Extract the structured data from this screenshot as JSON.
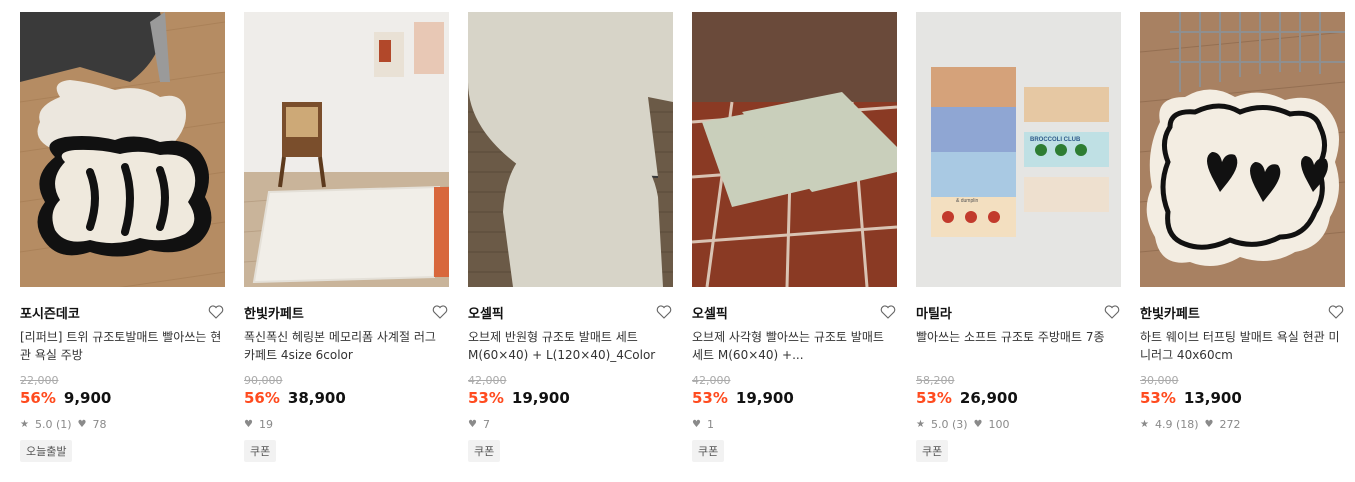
{
  "products": [
    {
      "brand": "포시즌데코",
      "title": "[리퍼브] 트위 규조토발매트 빨아쓰는 현관 욕실 주방",
      "original_price": "22,000",
      "discount": "56%",
      "price": "9,900",
      "rating": "5.0 (1)",
      "likes": "78",
      "badge": "오늘출발"
    },
    {
      "brand": "한빛카페트",
      "title": "폭신폭신 헤링본 메모리폼 사계절 러그 카페트 4size 6color",
      "original_price": "90,000",
      "discount": "56%",
      "price": "38,900",
      "likes": "19",
      "badge": "쿠폰"
    },
    {
      "brand": "오셀픽",
      "title": "오브제 반원형 규조토 발매트 세트 M(60×40) + L(120×40)_4Color",
      "original_price": "42,000",
      "discount": "53%",
      "price": "19,900",
      "likes": "7",
      "badge": "쿠폰"
    },
    {
      "brand": "오셀픽",
      "title": "오브제 사각형 빨아쓰는 규조토 발매트 세트 M(60×40) +...",
      "original_price": "42,000",
      "discount": "53%",
      "price": "19,900",
      "likes": "1",
      "badge": "쿠폰"
    },
    {
      "brand": "마틸라",
      "title": "빨아쓰는 소프트 규조토 주방매트 7종",
      "original_price": "58,200",
      "discount": "53%",
      "price": "26,900",
      "rating": "5.0 (3)",
      "likes": "100",
      "badge": "쿠폰"
    },
    {
      "brand": "한빛카페트",
      "title": "하트 웨이브 터프팅 발매트 욕실 현관 미니러그 40x60cm",
      "original_price": "30,000",
      "discount": "53%",
      "price": "13,900",
      "rating": "4.9 (18)",
      "likes": "272"
    }
  ],
  "mat4_labels": {
    "brand_text": "BROCCOLI CLUB",
    "small_text": "& dumplin"
  },
  "colors": {
    "discount": "#ff4b1f",
    "badge_bg": "#f2f2f2"
  },
  "icons": {
    "wishlist": "heart-outline-icon",
    "rating": "star-icon",
    "likes": "heart-filled-icon"
  }
}
